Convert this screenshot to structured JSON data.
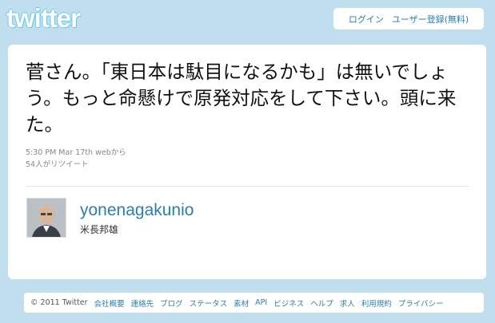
{
  "header": {
    "logo_text": "twitter",
    "login_label": "ログイン",
    "signup_label": "ユーザー登録(無料)"
  },
  "tweet": {
    "text": "菅さん。「東日本は駄目になるかも」は無いでしょう。もっと命懸けで原発対応をして下さい。頭に来た。",
    "timestamp": "5:30 PM Mar 17th webから",
    "retweets": "54人がリツイート"
  },
  "author": {
    "username": "yonenagakunio",
    "full_name": "米長邦雄"
  },
  "footer": {
    "copyright": "© 2011 Twitter",
    "links": [
      "会社概要",
      "連絡先",
      "ブログ",
      "ステータス",
      "素材",
      "API",
      "ビジネス",
      "ヘルプ",
      "求人",
      "利用規約",
      "プライバシー"
    ]
  },
  "colors": {
    "background": "#c0deed",
    "link": "#2a7fb1"
  }
}
